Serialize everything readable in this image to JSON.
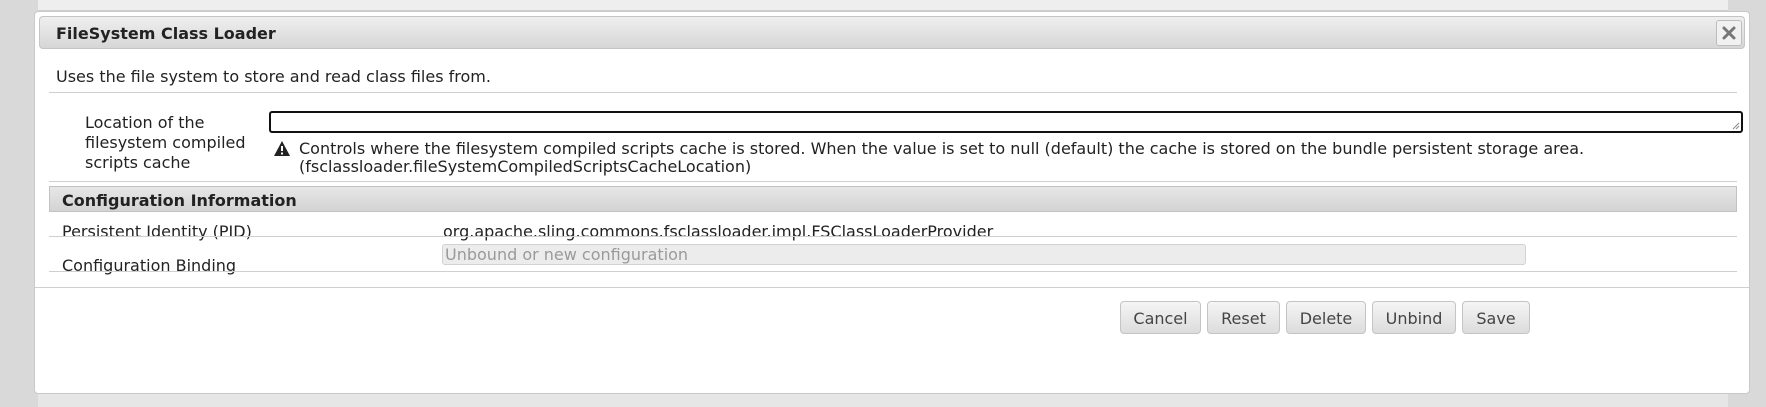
{
  "dialog": {
    "title": "FileSystem Class Loader",
    "close_icon": "close-icon",
    "intro": "Uses the file system to store and read class files from."
  },
  "property": {
    "label": "Location of the filesystem compiled scripts cache",
    "value": "",
    "warning_icon": "warning-icon",
    "description_line1": "Controls where the filesystem compiled scripts cache is stored. When the value is set to null (default) the cache is stored on the bundle persistent storage area.",
    "description_line2": "(fsclassloader.fileSystemCompiledScriptsCacheLocation)"
  },
  "config_info": {
    "header": "Configuration Information",
    "pid_label": "Persistent Identity (PID)",
    "pid_value": "org.apache.sling.commons.fsclassloader.impl.FSClassLoaderProvider",
    "binding_label": "Configuration Binding",
    "binding_placeholder": "Unbound or new configuration"
  },
  "buttons": {
    "cancel": "Cancel",
    "reset": "Reset",
    "delete": "Delete",
    "unbind": "Unbind",
    "save": "Save"
  }
}
